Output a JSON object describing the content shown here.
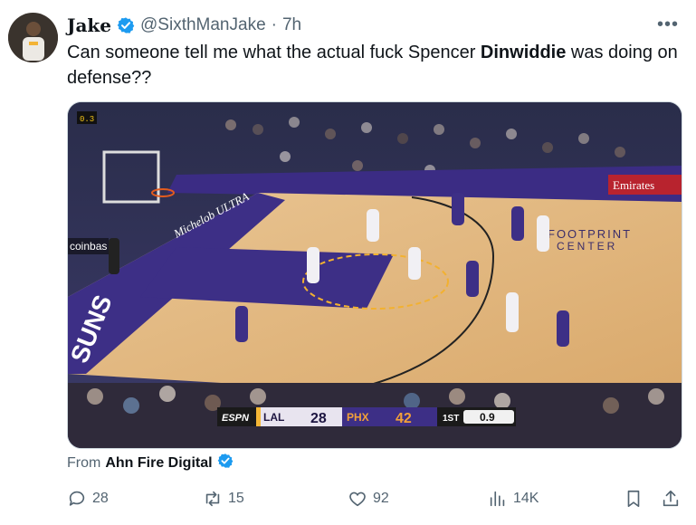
{
  "tweet": {
    "author_name": "Jake",
    "author_handle": "@SixthManJake",
    "separator": "·",
    "time": "7h",
    "more": "•••",
    "text_before": "Can someone tell me what the actual fuck Spencer ",
    "text_bold": "Dinwiddie",
    "text_after": " was doing on defense??"
  },
  "media": {
    "scoreboard": {
      "network": "ESPN",
      "team1": "LAL",
      "score1": "28",
      "team2": "PHX",
      "score2": "42",
      "quarter": "1ST",
      "clock": "0.9"
    },
    "court_texts": {
      "emirates": "Emirates",
      "coinbase": "coinbas",
      "footprint_1": "FOOTPRINT",
      "footprint_2": "CENTER",
      "suns": "SUNS",
      "michelob": "Michelob ULTRA",
      "shot_clock": "0.3"
    }
  },
  "source": {
    "prefix": "From",
    "name": "Ahn Fire Digital"
  },
  "actions": {
    "replies": "28",
    "retweets": "15",
    "likes": "92",
    "views": "14K"
  },
  "colors": {
    "verified": "#1d9bf0",
    "suns_purple": "#3d2f86",
    "court_wood": "#e2b77f",
    "text_secondary": "#536471"
  }
}
